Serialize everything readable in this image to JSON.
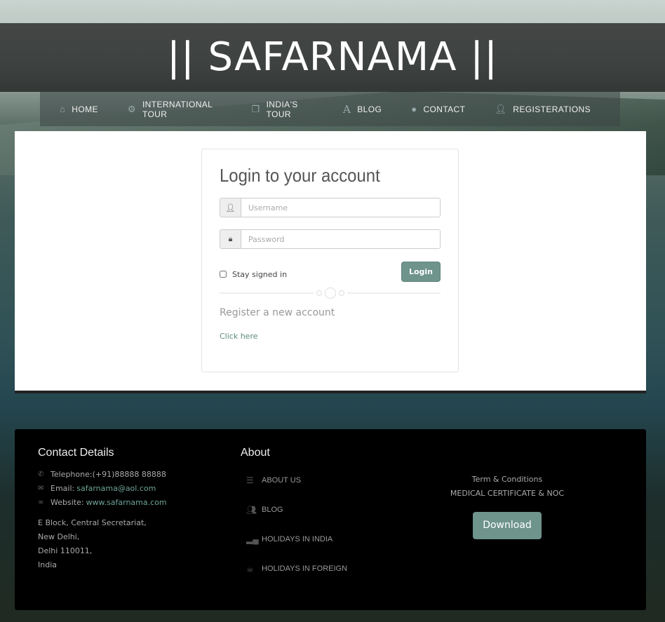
{
  "header": {
    "title": "|| SAFARNAMA ||"
  },
  "nav": [
    {
      "label": "HOME",
      "icon": "home-icon"
    },
    {
      "label": "INTERNATIONAL TOUR",
      "icon": "cogs-icon"
    },
    {
      "label": "INDIA'S TOUR",
      "icon": "copy-icon"
    },
    {
      "label": "BLOG",
      "icon": "font-icon"
    },
    {
      "label": "CONTACT",
      "icon": "comment-icon"
    },
    {
      "label": "REGISTERATIONS",
      "icon": "user-icon"
    }
  ],
  "login": {
    "title": "Login to your account",
    "username_placeholder": "Username",
    "password_placeholder": "Password",
    "stay_signed": "Stay signed in",
    "login_label": "Login",
    "register_text": "Register a new account",
    "click_here": "Click here"
  },
  "footer": {
    "contact_title": "Contact Details",
    "telephone": "Telephone:(+91)88888 88888",
    "email_label": "Email:",
    "email": "safarnama@aol.com",
    "website_label": "Website:",
    "website": "www.safarnama.com",
    "address": [
      "E Block, Central Secretariat,",
      "New Delhi,",
      "Delhi 110011,",
      "India"
    ],
    "about_title": "About",
    "about_items": [
      {
        "label": "ABOUT US",
        "icon": "list-icon"
      },
      {
        "label": "BLOG",
        "icon": "group-icon"
      },
      {
        "label": "HOLIDAYS IN INDIA",
        "icon": "signal-icon"
      },
      {
        "label": "HOLIDAYS IN FOREIGN",
        "icon": "coffee-icon"
      }
    ],
    "terms": "Term & Conditions",
    "medical": "MEDICAL CERTIFICATE & NOC",
    "download": "Download"
  },
  "colors": {
    "accent": "#6e948c",
    "link": "#6ea397"
  }
}
